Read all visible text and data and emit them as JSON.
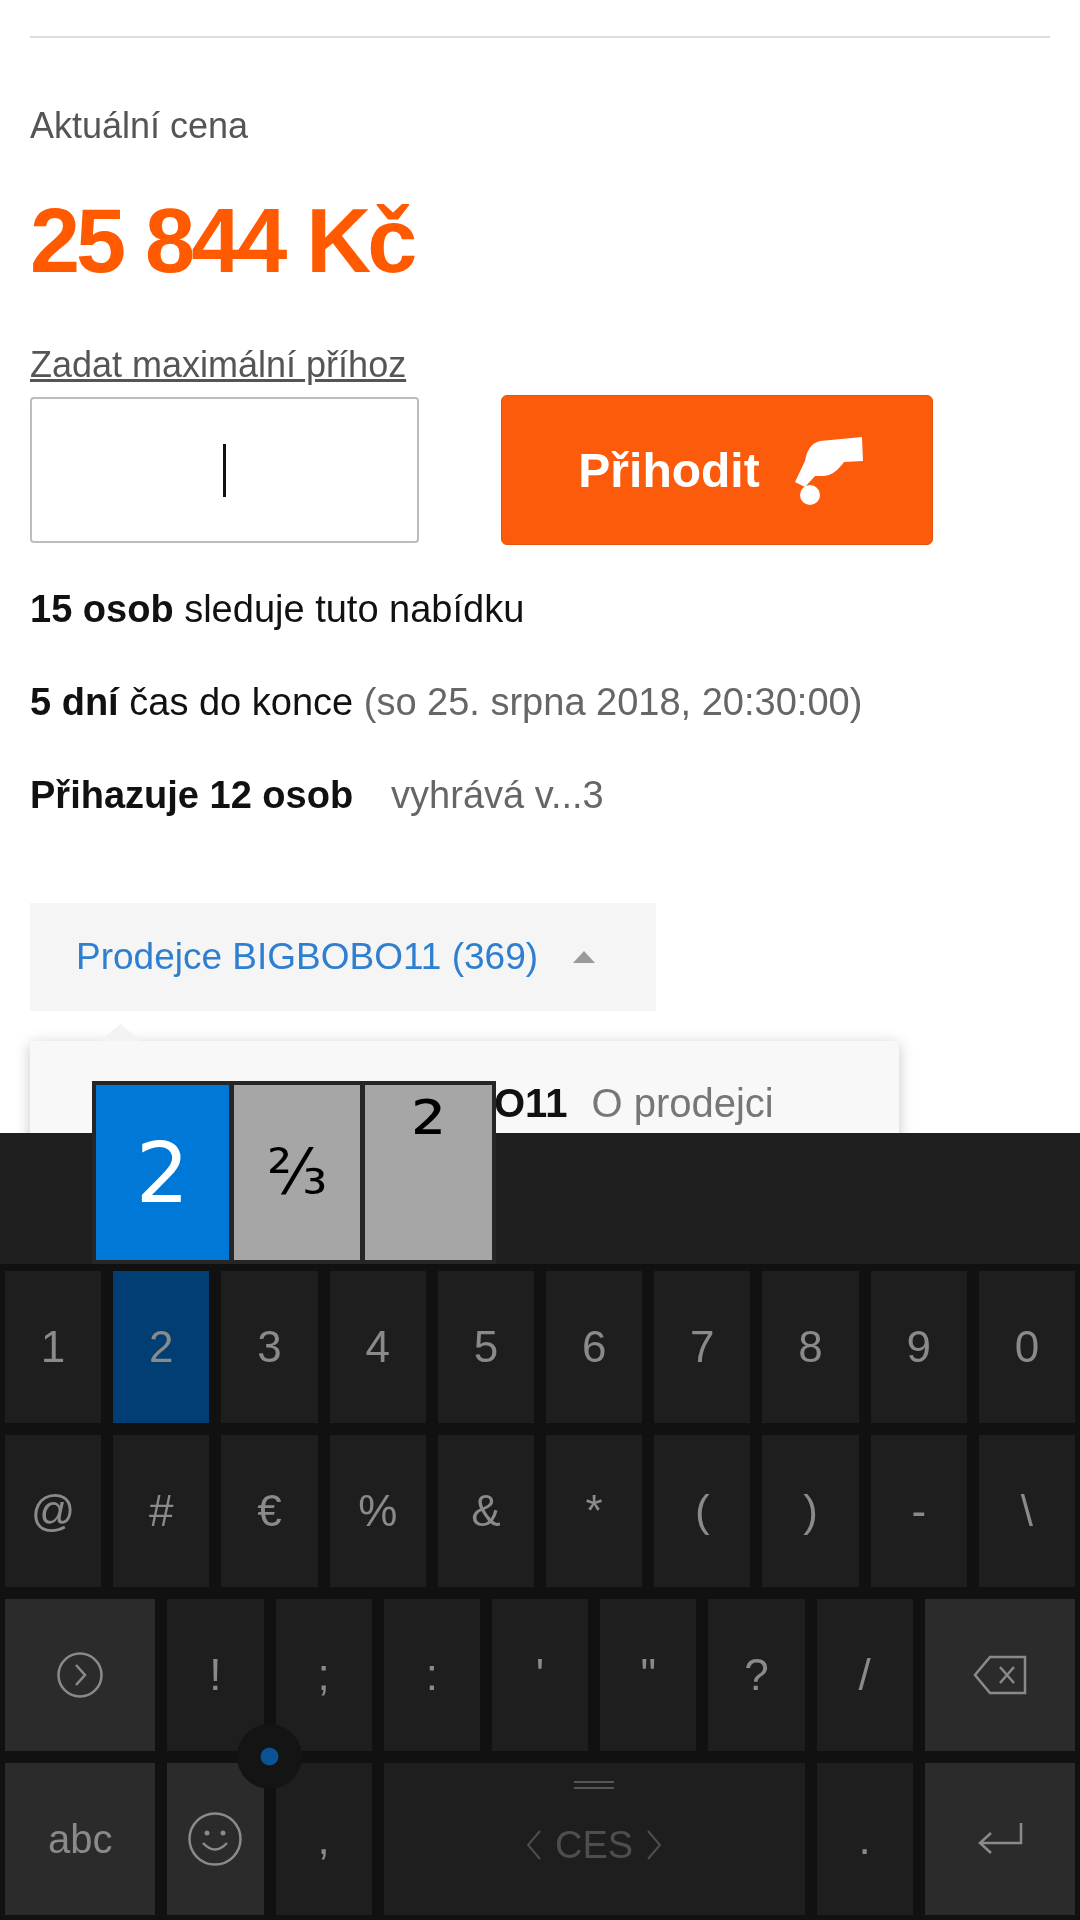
{
  "price": {
    "label": "Aktuální cena",
    "value": "25 844 Kč"
  },
  "bid": {
    "link": "Zadat maximální příhoz",
    "input": {
      "focused": true
    },
    "button": "Přihodit"
  },
  "stats": [
    {
      "kind": "watchers",
      "lead": "15 osob",
      "text": "sleduje tuto nabídku"
    },
    {
      "kind": "time_left",
      "lead": "5 dní",
      "text": "čas do konce",
      "note": "(so 25. srpna 2018, 20:30:00)"
    },
    {
      "kind": "bidders",
      "lead": "Přihazuje 12 osob",
      "note": "vyhrává v...3"
    }
  ],
  "seller": {
    "label": "Prodejce BIGBOBO11 (369)",
    "expanded": true,
    "popup": {
      "name": "O11",
      "link": "O prodejci"
    }
  },
  "keyboard": {
    "candidates": [
      {
        "label": "2",
        "selected": true
      },
      {
        "label": "⅔",
        "selected": false
      },
      {
        "label": "²",
        "selected": false
      }
    ],
    "rows": [
      {
        "keys": [
          {
            "kind": "char",
            "label": "1",
            "pressed": false
          },
          {
            "kind": "char",
            "label": "2",
            "pressed": true
          },
          {
            "kind": "char",
            "label": "3",
            "pressed": false
          },
          {
            "kind": "char",
            "label": "4",
            "pressed": false
          },
          {
            "kind": "char",
            "label": "5",
            "pressed": false
          },
          {
            "kind": "char",
            "label": "6",
            "pressed": false
          },
          {
            "kind": "char",
            "label": "7",
            "pressed": false
          },
          {
            "kind": "char",
            "label": "8",
            "pressed": false
          },
          {
            "kind": "char",
            "label": "9",
            "pressed": false
          },
          {
            "kind": "char",
            "label": "0",
            "pressed": false
          }
        ]
      },
      {
        "keys": [
          {
            "kind": "char",
            "label": "@",
            "pressed": false
          },
          {
            "kind": "char",
            "label": "#",
            "pressed": false
          },
          {
            "kind": "char",
            "label": "€",
            "pressed": false
          },
          {
            "kind": "char",
            "label": "%",
            "pressed": false
          },
          {
            "kind": "char",
            "label": "&",
            "pressed": false
          },
          {
            "kind": "char",
            "label": "*",
            "pressed": false
          },
          {
            "kind": "char",
            "label": "(",
            "pressed": false
          },
          {
            "kind": "char",
            "label": ")",
            "pressed": false
          },
          {
            "kind": "char",
            "label": "-",
            "pressed": false
          },
          {
            "kind": "char",
            "label": "\\",
            "pressed": false
          }
        ]
      },
      {
        "keys": [
          {
            "kind": "next",
            "pressed": false
          },
          {
            "kind": "char",
            "label": "!",
            "pressed": false
          },
          {
            "kind": "char",
            "label": ";",
            "pressed": false
          },
          {
            "kind": "char",
            "label": ":",
            "pressed": false
          },
          {
            "kind": "char",
            "label": "'",
            "pressed": false
          },
          {
            "kind": "char",
            "label": "\"",
            "pressed": false
          },
          {
            "kind": "char",
            "label": "?",
            "pressed": false
          },
          {
            "kind": "char",
            "label": "/",
            "pressed": false
          },
          {
            "kind": "backspace",
            "pressed": false
          }
        ]
      },
      {
        "keys": [
          {
            "kind": "mode",
            "label": "abc",
            "pressed": false
          },
          {
            "kind": "emoji",
            "pressed": false
          },
          {
            "kind": "char",
            "label": ",",
            "pressed": false
          },
          {
            "kind": "space",
            "label": "CES",
            "pressed": false
          },
          {
            "kind": "char",
            "label": ".",
            "pressed": false
          },
          {
            "kind": "enter",
            "pressed": false
          }
        ]
      }
    ]
  }
}
